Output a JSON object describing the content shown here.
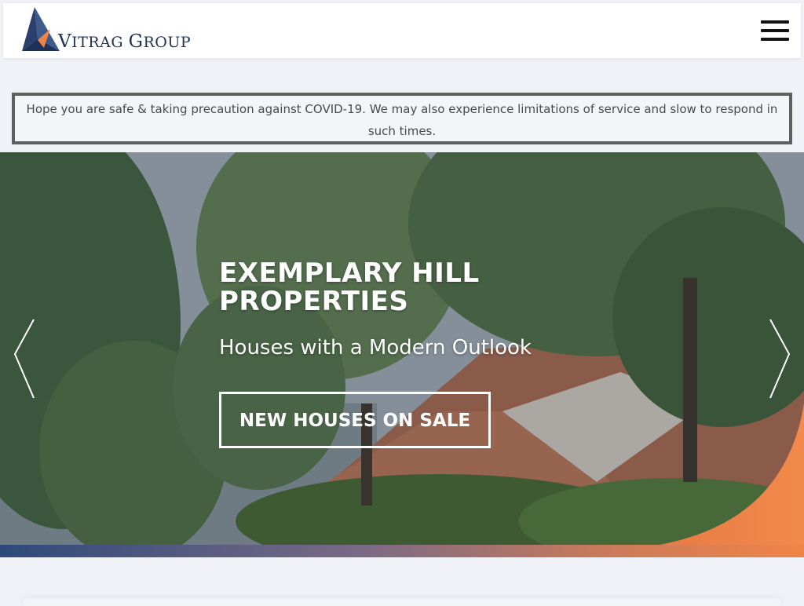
{
  "brand": {
    "name_first_cap": "V",
    "name_rest_1": "ITRAG ",
    "name_second_cap": "G",
    "name_rest_2": "ROUP",
    "colors": {
      "navy": "#223355",
      "orange": "#f08447"
    }
  },
  "header": {
    "menu_icon": "hamburger-icon"
  },
  "notice": {
    "text": "Hope you are safe & taking precaution against COVID-19. We may also experience limitations of service and slow to respond in such times."
  },
  "hero": {
    "title": "EXEMPLARY HILL PROPERTIES",
    "subtitle": "Houses with a Modern Outlook",
    "cta_label": "NEW HOUSES ON SALE",
    "prev_icon": "chevron-left-icon",
    "next_icon": "chevron-right-icon"
  }
}
